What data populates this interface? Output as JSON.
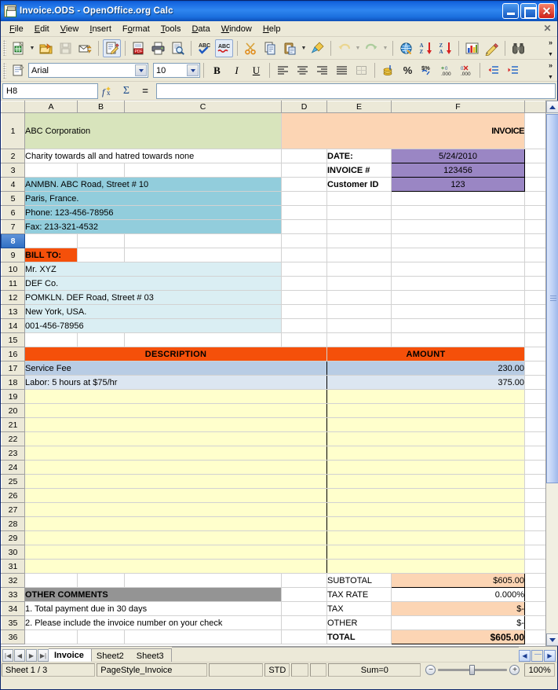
{
  "window": {
    "title": "Invoice.ODS - OpenOffice.org Calc",
    "icon": "calc-document-icon",
    "minimize_label": "Minimize",
    "maximize_label": "Maximize",
    "close_label": "✕"
  },
  "menubar": {
    "items": [
      "File",
      "Edit",
      "View",
      "Insert",
      "Format",
      "Tools",
      "Data",
      "Window",
      "Help"
    ],
    "close_doc": "✕"
  },
  "toolbars": {
    "overflow_glyph": "»",
    "standard": [
      {
        "name": "new-document-icon",
        "title": "New"
      },
      {
        "name": "new-dropdown-caret-icon",
        "title": "New dropdown"
      },
      {
        "name": "open-folder-icon",
        "title": "Open"
      },
      {
        "name": "save-icon",
        "title": "Save"
      },
      {
        "name": "email-document-icon",
        "title": "Document as E-mail"
      },
      {
        "name": "edit-file-icon",
        "title": "Edit File"
      },
      {
        "name": "export-pdf-icon",
        "title": "Export as PDF"
      },
      {
        "name": "print-icon",
        "title": "Print File Directly"
      },
      {
        "name": "print-preview-icon",
        "title": "Page Preview"
      },
      {
        "name": "spellcheck-icon",
        "title": "Spellcheck"
      },
      {
        "name": "autospellcheck-icon",
        "title": "AutoSpellcheck"
      },
      {
        "name": "cut-scissors-icon",
        "title": "Cut"
      },
      {
        "name": "copy-icon",
        "title": "Copy"
      },
      {
        "name": "paste-icon",
        "title": "Paste"
      },
      {
        "name": "paste-dropdown-caret-icon",
        "title": "Paste dropdown"
      },
      {
        "name": "clone-formatting-brush-icon",
        "title": "Clone Formatting"
      },
      {
        "name": "undo-icon",
        "title": "Undo"
      },
      {
        "name": "undo-dropdown-caret-icon",
        "title": "Undo dropdown"
      },
      {
        "name": "redo-icon",
        "title": "Redo"
      },
      {
        "name": "redo-dropdown-caret-icon",
        "title": "Redo dropdown"
      },
      {
        "name": "hyperlink-globe-icon",
        "title": "Hyperlink"
      },
      {
        "name": "sort-ascending-icon",
        "title": "Sort Ascending"
      },
      {
        "name": "sort-descending-icon",
        "title": "Sort Descending"
      },
      {
        "name": "chart-icon",
        "title": "Insert Chart"
      },
      {
        "name": "draw-functions-icon",
        "title": "Show Draw Functions"
      },
      {
        "name": "find-replace-binoculars-icon",
        "title": "Find & Replace"
      }
    ],
    "formatting": {
      "font_name": "Arial",
      "font_size": "10",
      "bold_label": "B",
      "italic_label": "I",
      "underline_label": "U",
      "buttons": [
        {
          "name": "styles-catalog-icon",
          "title": "Styles and Formatting"
        },
        {
          "name": "align-left-icon",
          "title": "Align Left"
        },
        {
          "name": "align-center-icon",
          "title": "Align Center Horizontally"
        },
        {
          "name": "align-right-icon",
          "title": "Align Right"
        },
        {
          "name": "justified-icon",
          "title": "Justified"
        },
        {
          "name": "borders-icon",
          "title": "Borders"
        },
        {
          "name": "currency-format-icon",
          "title": "Number Format: Currency"
        },
        {
          "name": "percent-format-icon",
          "title": "Number Format: Percent"
        },
        {
          "name": "number-format-standard-icon",
          "title": "Number Format: Standard"
        },
        {
          "name": "add-decimal-place-icon",
          "title": "Add Decimal Place"
        },
        {
          "name": "delete-decimal-place-icon",
          "title": "Delete Decimal Place"
        },
        {
          "name": "decrease-indent-icon",
          "title": "Decrease Indent"
        },
        {
          "name": "increase-indent-icon",
          "title": "Increase Indent"
        }
      ],
      "percent_glyph": "%"
    }
  },
  "formula_bar": {
    "cell_reference": "H8",
    "formula_value": "",
    "formula_placeholder": "",
    "function_wizard_label": "fx",
    "sum_label": "Σ",
    "equals_label": "="
  },
  "grid": {
    "columns": [
      "A",
      "B",
      "C",
      "D",
      "E",
      "F"
    ],
    "selected_row": 8,
    "rows": [
      1,
      2,
      3,
      4,
      5,
      6,
      7,
      8,
      9,
      10,
      11,
      12,
      13,
      14,
      15,
      16,
      17,
      18,
      19,
      20,
      21,
      22,
      23,
      24,
      25,
      26,
      27,
      28,
      29,
      30,
      31,
      32,
      33,
      34,
      35,
      36
    ]
  },
  "invoice": {
    "company_name": "ABC Corporation",
    "doc_title": "INVOICE",
    "tagline": "Charity towards all and hatred towards none",
    "meta": [
      {
        "label": "DATE:",
        "value": "5/24/2010"
      },
      {
        "label": "INVOICE #",
        "value": "123456"
      },
      {
        "label": "Customer ID",
        "value": "123"
      }
    ],
    "company_address": [
      "ANMBN. ABC Road, Street # 10",
      "Paris, France.",
      "Phone: 123-456-78956",
      "Fax: 213-321-4532"
    ],
    "bill_to_label": "BILL TO:",
    "bill_to": [
      "Mr. XYZ",
      "DEF Co.",
      "POMKLN. DEF Road, Street # 03",
      "New York, USA.",
      "001-456-78956"
    ],
    "table_headers": {
      "description": "DESCRIPTION",
      "amount": "AMOUNT"
    },
    "line_items": [
      {
        "description": "Service Fee",
        "amount": "230.00"
      },
      {
        "description": "Labor: 5 hours at $75/hr",
        "amount": "375.00"
      }
    ],
    "totals": [
      {
        "label": "SUBTOTAL",
        "value": "$605.00"
      },
      {
        "label": "TAX RATE",
        "value": "0.000%"
      },
      {
        "label": "TAX",
        "value": "$-"
      },
      {
        "label": "OTHER",
        "value": "$-"
      },
      {
        "label": "TOTAL",
        "value": "$605.00"
      }
    ],
    "comments_header": "OTHER COMMENTS",
    "comments": [
      "1. Total payment due in 30 days",
      "2. Please include the invoice number on your check"
    ],
    "colors": {
      "header_green": "#d8e4bc",
      "header_peach": "#fcd5b4",
      "accent_orange": "#f5500a",
      "title_orange": "#ffa52a",
      "company_teal": "#31859b",
      "address_blue": "#92cddc",
      "billto_blue": "#daeef3",
      "item_row_blue": "#b8cce4",
      "empty_row_yellow": "#ffffcc",
      "meta_purple": "#9a86c4",
      "comments_gray": "#949494"
    }
  },
  "sheet_tabs": {
    "first_label": "⏮",
    "prev_label": "◀",
    "next_label": "▶",
    "last_label": "⏭",
    "tabs": [
      {
        "label": "Invoice",
        "active": true
      },
      {
        "label": "Sheet2",
        "active": false
      },
      {
        "label": "Sheet3",
        "active": false
      }
    ],
    "scroll_left": "◀",
    "scroll_right": "▶"
  },
  "status_bar": {
    "sheet_info": "Sheet 1 / 3",
    "page_style": "PageStyle_Invoice",
    "field_3": "",
    "field_4": "",
    "selection_mode": "STD",
    "modified": "",
    "signature": "",
    "sum": "Sum=0",
    "zoom_out": "−",
    "zoom_in": "+",
    "zoom_level": "100%"
  }
}
